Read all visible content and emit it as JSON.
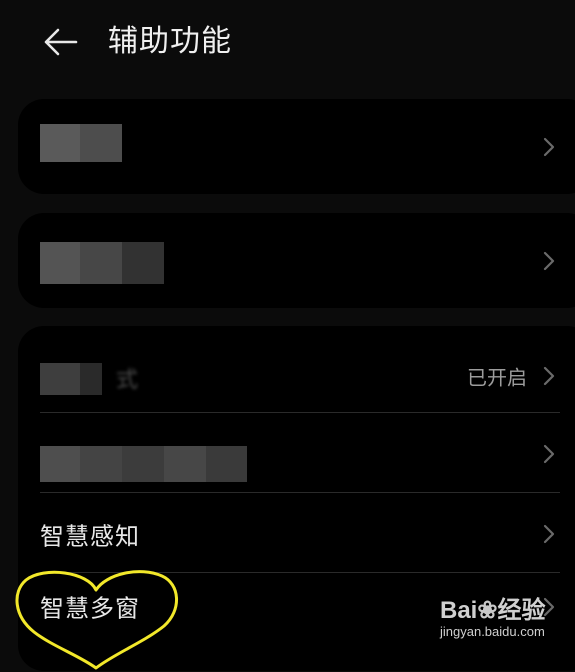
{
  "header": {
    "back_icon": "arrow-left-icon",
    "title": "辅助功能"
  },
  "cards": {
    "card1": {
      "row1": {
        "label_redacted": true,
        "chevron": "chevron-right-icon"
      }
    },
    "card2": {
      "row1": {
        "label_redacted": true,
        "chevron": "chevron-right-icon"
      }
    },
    "card3": {
      "row1": {
        "label_partial": "式",
        "value": "已开启",
        "chevron": "chevron-right-icon"
      },
      "row2": {
        "label_redacted": true,
        "chevron": "chevron-right-icon"
      },
      "row3": {
        "label": "智慧感知",
        "chevron": "chevron-right-icon"
      },
      "row4": {
        "label": "智慧多窗",
        "chevron": "chevron-right-icon"
      }
    }
  },
  "annotation": {
    "shape": "heart",
    "color": "#f2e82a"
  },
  "watermark": {
    "logo_prefix": "Bai",
    "logo_suffix": "经验",
    "url": "jingyan.baidu.com"
  },
  "colors": {
    "background": "#0b0b0b",
    "card": "#000000",
    "text": "#e8e8e8",
    "secondary_text": "#9c9c9c",
    "chevron": "#6a6a6a",
    "annotation": "#f2e82a"
  }
}
